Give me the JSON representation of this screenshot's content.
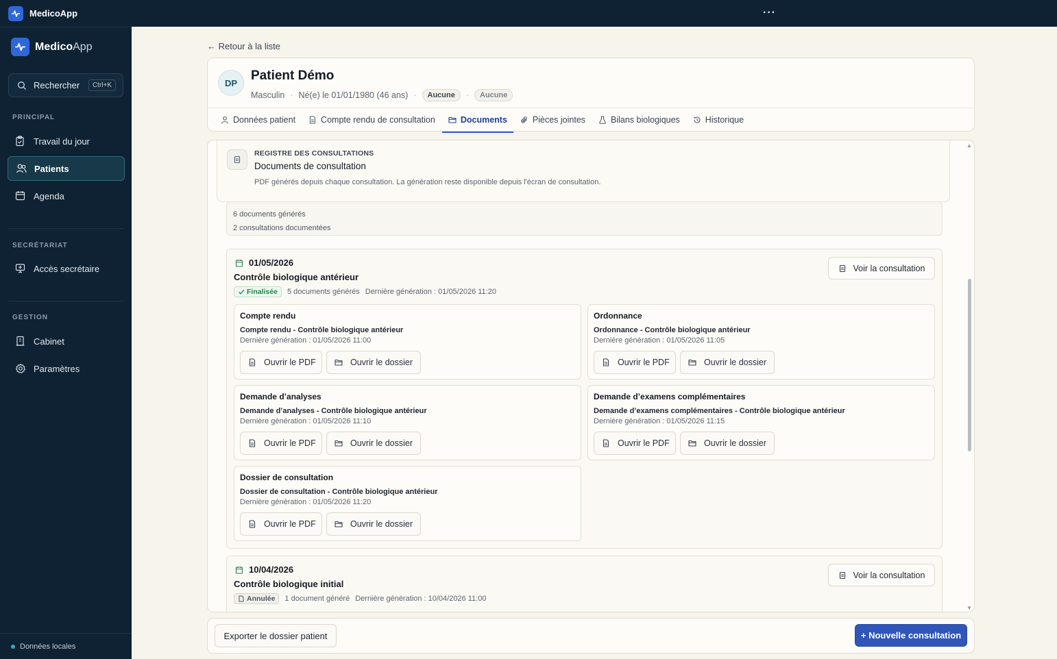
{
  "titlebar": {
    "title": "MedicoApp",
    "menu_glyph": "···"
  },
  "sidebar": {
    "brand_bold": "Medico",
    "brand_light": "App",
    "search_label": "Rechercher",
    "search_shortcut": "Ctrl+K",
    "sections": {
      "principal": "PRINCIPAL",
      "secretariat": "SECRÉTARIAT",
      "gestion": "GESTION"
    },
    "items": [
      {
        "label": "Travail du jour",
        "icon": "clipboard-icon"
      },
      {
        "label": "Patients",
        "icon": "users-icon",
        "active": true
      },
      {
        "label": "Agenda",
        "icon": "calendar-icon"
      },
      {
        "label": "Accès secrétaire",
        "icon": "secretary-icon"
      },
      {
        "label": "Cabinet",
        "icon": "building-icon"
      },
      {
        "label": "Paramètres",
        "icon": "gear-icon"
      }
    ],
    "footer": "Données locales"
  },
  "back_link": "← Retour à la liste",
  "patient": {
    "initials": "DP",
    "name": "Patient Démo",
    "sex": "Masculin",
    "birth": "Né(e) le 01/01/1980 (46 ans)",
    "tag1": "Aucune",
    "tag2": "Aucune",
    "sep": "·"
  },
  "tabs": [
    {
      "label": "Données patient",
      "icon": "user-icon"
    },
    {
      "label": "Compte rendu de consultation",
      "icon": "file-icon"
    },
    {
      "label": "Documents",
      "icon": "folder-icon",
      "active": true
    },
    {
      "label": "Pièces jointes",
      "icon": "paperclip-icon"
    },
    {
      "label": "Bilans biologiques",
      "icon": "flask-icon"
    },
    {
      "label": "Historique",
      "icon": "history-icon"
    }
  ],
  "registry": {
    "kicker": "REGISTRE DES CONSULTATIONS",
    "title": "Documents de consultation",
    "description": "PDF générés depuis chaque consultation. La génération reste disponible depuis l'écran de consultation.",
    "stats_docs": "6 documents générés",
    "stats_consults": "2 consultations documentées"
  },
  "consultations": [
    {
      "date": "01/05/2026",
      "title": "Contrôle biologique antérieur",
      "status": "Finalisée",
      "count": "5 documents générés",
      "last": "Dernière génération : 01/05/2026 11:20",
      "view_label": "Voir la consultation",
      "documents": [
        {
          "type": "Compte rendu",
          "name": "Compte rendu - Contrôle biologique antérieur",
          "date": "Dernière génération : 01/05/2026 11:00"
        },
        {
          "type": "Ordonnance",
          "name": "Ordonnance - Contrôle biologique antérieur",
          "date": "Dernière génération : 01/05/2026 11:05"
        },
        {
          "type": "Demande d’analyses",
          "name": "Demande d’analyses - Contrôle biologique antérieur",
          "date": "Dernière génération : 01/05/2026 11:10"
        },
        {
          "type": "Demande d’examens complémentaires",
          "name": "Demande d’examens complémentaires - Contrôle biologique antérieur",
          "date": "Dernière génération : 01/05/2026 11:15"
        },
        {
          "type": "Dossier de consultation",
          "name": "Dossier de consultation - Contrôle biologique antérieur",
          "date": "Dernière génération : 01/05/2026 11:20"
        }
      ]
    },
    {
      "date": "10/04/2026",
      "title": "Contrôle biologique initial",
      "status": "Annulée",
      "count": "1 document généré",
      "last": "Dernière génération : 10/04/2026 11:00",
      "view_label": "Voir la consultation"
    }
  ],
  "buttons": {
    "open_pdf": "Ouvrir le PDF",
    "open_folder": "Ouvrir le dossier",
    "export": "Exporter le dossier patient",
    "new_consultation": "+ Nouvelle consultation"
  },
  "colors": {
    "sidebar_bg": "#0f2233",
    "accent": "#2f56b8",
    "success": "#23854a",
    "page_bg": "#f7f4ec"
  }
}
